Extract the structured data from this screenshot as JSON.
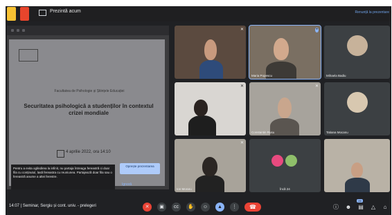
{
  "topbar": {
    "window_title": "Prezintă acum",
    "right_link": "Renunță la prezentare"
  },
  "presentation": {
    "slide": {
      "university": "",
      "faculty": "Facultatea de Psihologie și Științele Educației",
      "title": "Securitatea psihologică a studenților în contextul crizei mondiale",
      "speaker": "",
      "date": "4 aprilie 2022, ora 14:10"
    },
    "caption": "Pentru a evita oglindirea la infinit, nu partaja întreaga fereastră ci doar fila cu conținutul, lasă fereastra cu reuniunea. Partajează doar fila sau o fereastră anume a altei ferestre.",
    "stop_button": "Oprește prezentarea",
    "ignore_button": "Ignoră"
  },
  "participants": [
    {
      "name": "",
      "mic_icon": "mic-off-icon"
    },
    {
      "name": "Maria Popescu",
      "mic_icon": "speaking-icon"
    },
    {
      "name": "Mihaela Badiu",
      "mic_icon": ""
    },
    {
      "name": "",
      "mic_icon": "mic-off-icon"
    },
    {
      "name": "Constantin Rusu",
      "mic_icon": "mic-off-icon"
    },
    {
      "name": "Tatiana Mocanu",
      "mic_icon": ""
    },
    {
      "name": "Ion Moraru",
      "mic_icon": "mic-off-icon"
    },
    {
      "name": "Încă 24",
      "mic_icon": ""
    },
    {
      "name": "",
      "mic_icon": ""
    }
  ],
  "bottombar": {
    "time_and_meeting": "14:07 | Seminar, Sergiu și cont. univ. - prelegeri"
  },
  "controls": {
    "mic_icon": "mic-off-icon",
    "camera_icon": "camera-icon",
    "captions_icon": "captions-icon",
    "hand_icon": "raise-hand-icon",
    "emoji_icon": "emoji-icon",
    "present_icon": "present-icon",
    "more_icon": "more-icon",
    "end_icon": "end-call-icon",
    "info_icon": "info-icon",
    "people_icon": "people-icon",
    "chat_icon": "chat-icon",
    "activities_icon": "activities-icon",
    "lock_icon": "host-controls-icon",
    "people_count": "26"
  },
  "colors": {
    "background": "#202124",
    "tile": "#3c4043",
    "accent": "#8ab4f8",
    "end_call": "#ea4335"
  }
}
